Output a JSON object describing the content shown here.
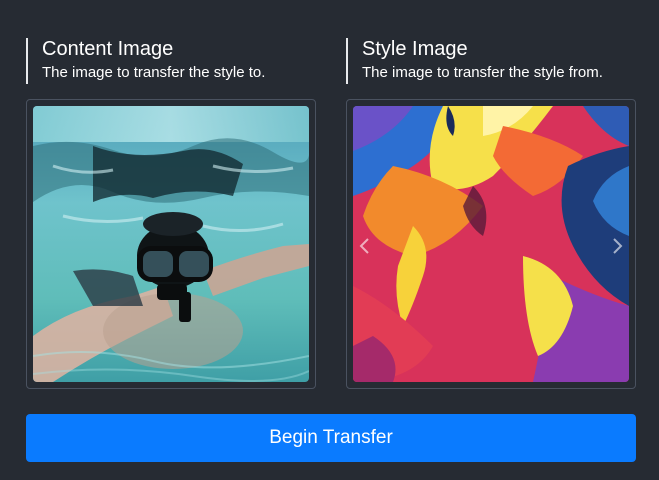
{
  "content": {
    "title": "Content Image",
    "subtitle": "The image to transfer the style to."
  },
  "style": {
    "title": "Style Image",
    "subtitle": "The image to transfer the style from."
  },
  "action": {
    "button_label": "Begin Transfer"
  },
  "colors": {
    "background": "#262b33",
    "accent": "#0a7bff",
    "frame_border": "#4a5260"
  },
  "icons": {
    "prev": "chevron-left-icon",
    "next": "chevron-right-icon"
  }
}
